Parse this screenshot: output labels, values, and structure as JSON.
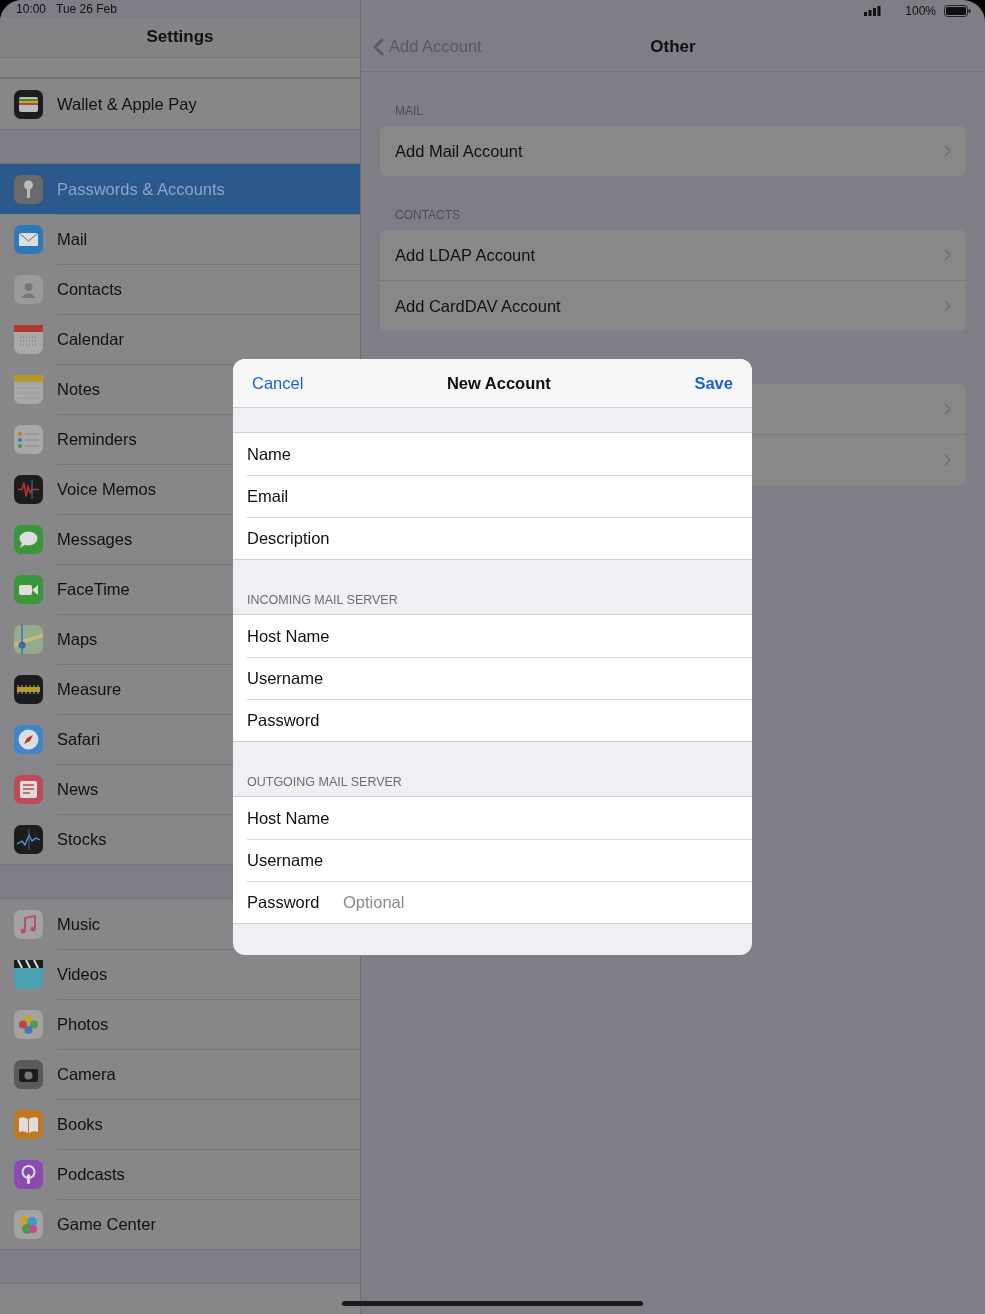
{
  "status_bar": {
    "time": "10:00",
    "date": "Tue 26 Feb",
    "battery": "100%"
  },
  "sidebar": {
    "title": "Settings",
    "groups": [
      {
        "items": [
          {
            "label": "Wallet & Apple Pay",
            "selected": false
          }
        ]
      },
      {
        "items": [
          {
            "label": "Passwords & Accounts",
            "selected": true
          },
          {
            "label": "Mail",
            "selected": false
          },
          {
            "label": "Contacts",
            "selected": false
          },
          {
            "label": "Calendar",
            "selected": false
          },
          {
            "label": "Notes",
            "selected": false
          },
          {
            "label": "Reminders",
            "selected": false
          },
          {
            "label": "Voice Memos",
            "selected": false
          },
          {
            "label": "Messages",
            "selected": false
          },
          {
            "label": "FaceTime",
            "selected": false
          },
          {
            "label": "Maps",
            "selected": false
          },
          {
            "label": "Measure",
            "selected": false
          },
          {
            "label": "Safari",
            "selected": false
          },
          {
            "label": "News",
            "selected": false
          },
          {
            "label": "Stocks",
            "selected": false
          }
        ]
      },
      {
        "items": [
          {
            "label": "Music",
            "selected": false
          },
          {
            "label": "Videos",
            "selected": false
          },
          {
            "label": "Photos",
            "selected": false
          },
          {
            "label": "Camera",
            "selected": false
          },
          {
            "label": "Books",
            "selected": false
          },
          {
            "label": "Podcasts",
            "selected": false
          },
          {
            "label": "Game Center",
            "selected": false
          }
        ]
      }
    ]
  },
  "detail": {
    "back": "Add Account",
    "title": "Other",
    "sections": [
      {
        "header": "MAIL",
        "rows": [
          {
            "kind": "link",
            "label": "Add Mail Account"
          }
        ]
      },
      {
        "header": "CONTACTS",
        "rows": [
          {
            "kind": "link",
            "label": "Add LDAP Account"
          },
          {
            "kind": "link",
            "label": "Add CardDAV Account"
          }
        ]
      },
      {
        "rows": [
          {
            "kind": "link"
          },
          {
            "kind": "link"
          }
        ]
      }
    ]
  },
  "modal": {
    "cancel": "Cancel",
    "title": "New Account",
    "save": "Save",
    "sections": [
      {
        "fields": [
          {
            "label": "Name"
          },
          {
            "label": "Email"
          },
          {
            "label": "Description"
          }
        ]
      },
      {
        "header": "INCOMING MAIL SERVER",
        "fields": [
          {
            "label": "Host Name"
          },
          {
            "label": "Username"
          },
          {
            "label": "Password"
          }
        ]
      },
      {
        "header": "OUTGOING MAIL SERVER",
        "fields": [
          {
            "label": "Host Name"
          },
          {
            "label": "Username"
          },
          {
            "label": "Password",
            "placeholder": "Optional"
          }
        ]
      }
    ]
  }
}
